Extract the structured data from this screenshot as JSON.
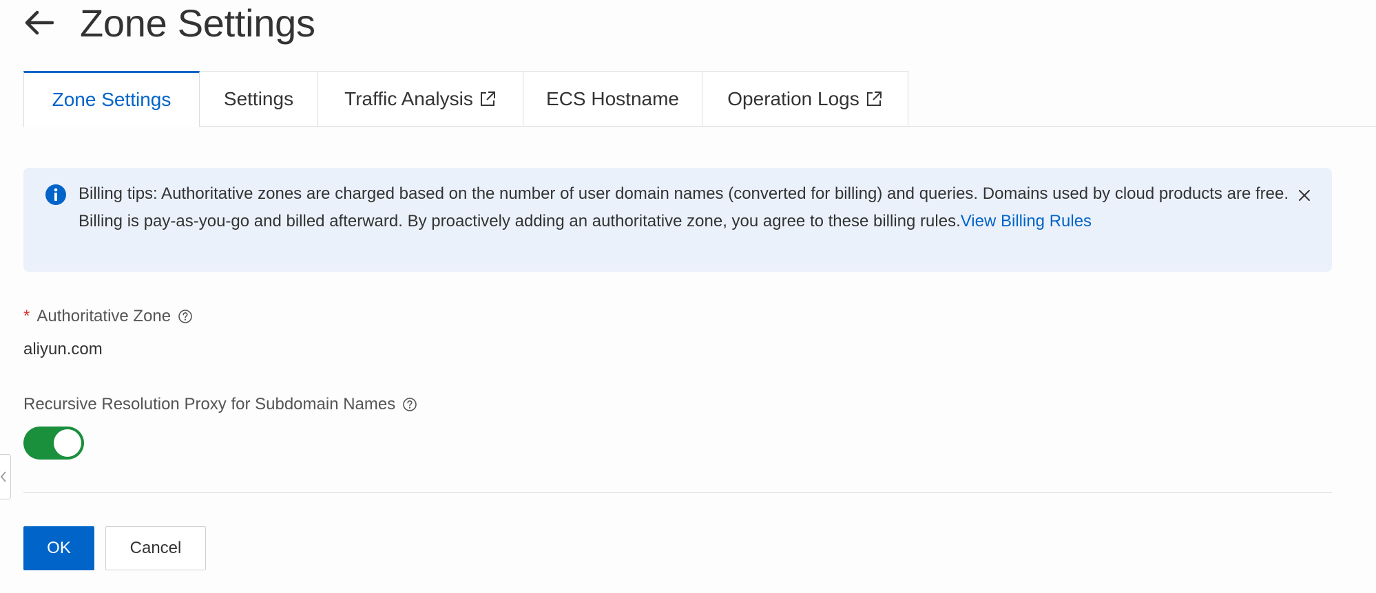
{
  "header": {
    "title": "Zone Settings",
    "back_icon": "arrow-left-icon"
  },
  "tabs": [
    {
      "label": "Zone Settings",
      "active": true,
      "external": false
    },
    {
      "label": "Settings",
      "active": false,
      "external": false
    },
    {
      "label": "Traffic Analysis",
      "active": false,
      "external": true
    },
    {
      "label": "ECS Hostname",
      "active": false,
      "external": false
    },
    {
      "label": "Operation Logs",
      "active": false,
      "external": true
    }
  ],
  "alert": {
    "icon": "info-icon",
    "text": "Billing tips: Authoritative zones are charged based on the number of user domain names (converted for billing) and queries. Domains used by cloud products are free. Billing is pay-as-you-go and billed afterward. By proactively adding an authoritative zone, you agree to these billing rules.",
    "link_text": "View Billing Rules",
    "close_icon": "close-icon"
  },
  "form": {
    "zone": {
      "required_mark": "*",
      "label": "Authoritative Zone",
      "value": "aliyun.com"
    },
    "proxy": {
      "label": "Recursive Resolution Proxy for Subdomain Names",
      "enabled": true
    },
    "ok_label": "OK",
    "cancel_label": "Cancel"
  },
  "colors": {
    "accent": "#0064c8",
    "toggle_on": "#1a8f3c",
    "alert_bg": "#ebf1fa",
    "required": "#d93026"
  }
}
